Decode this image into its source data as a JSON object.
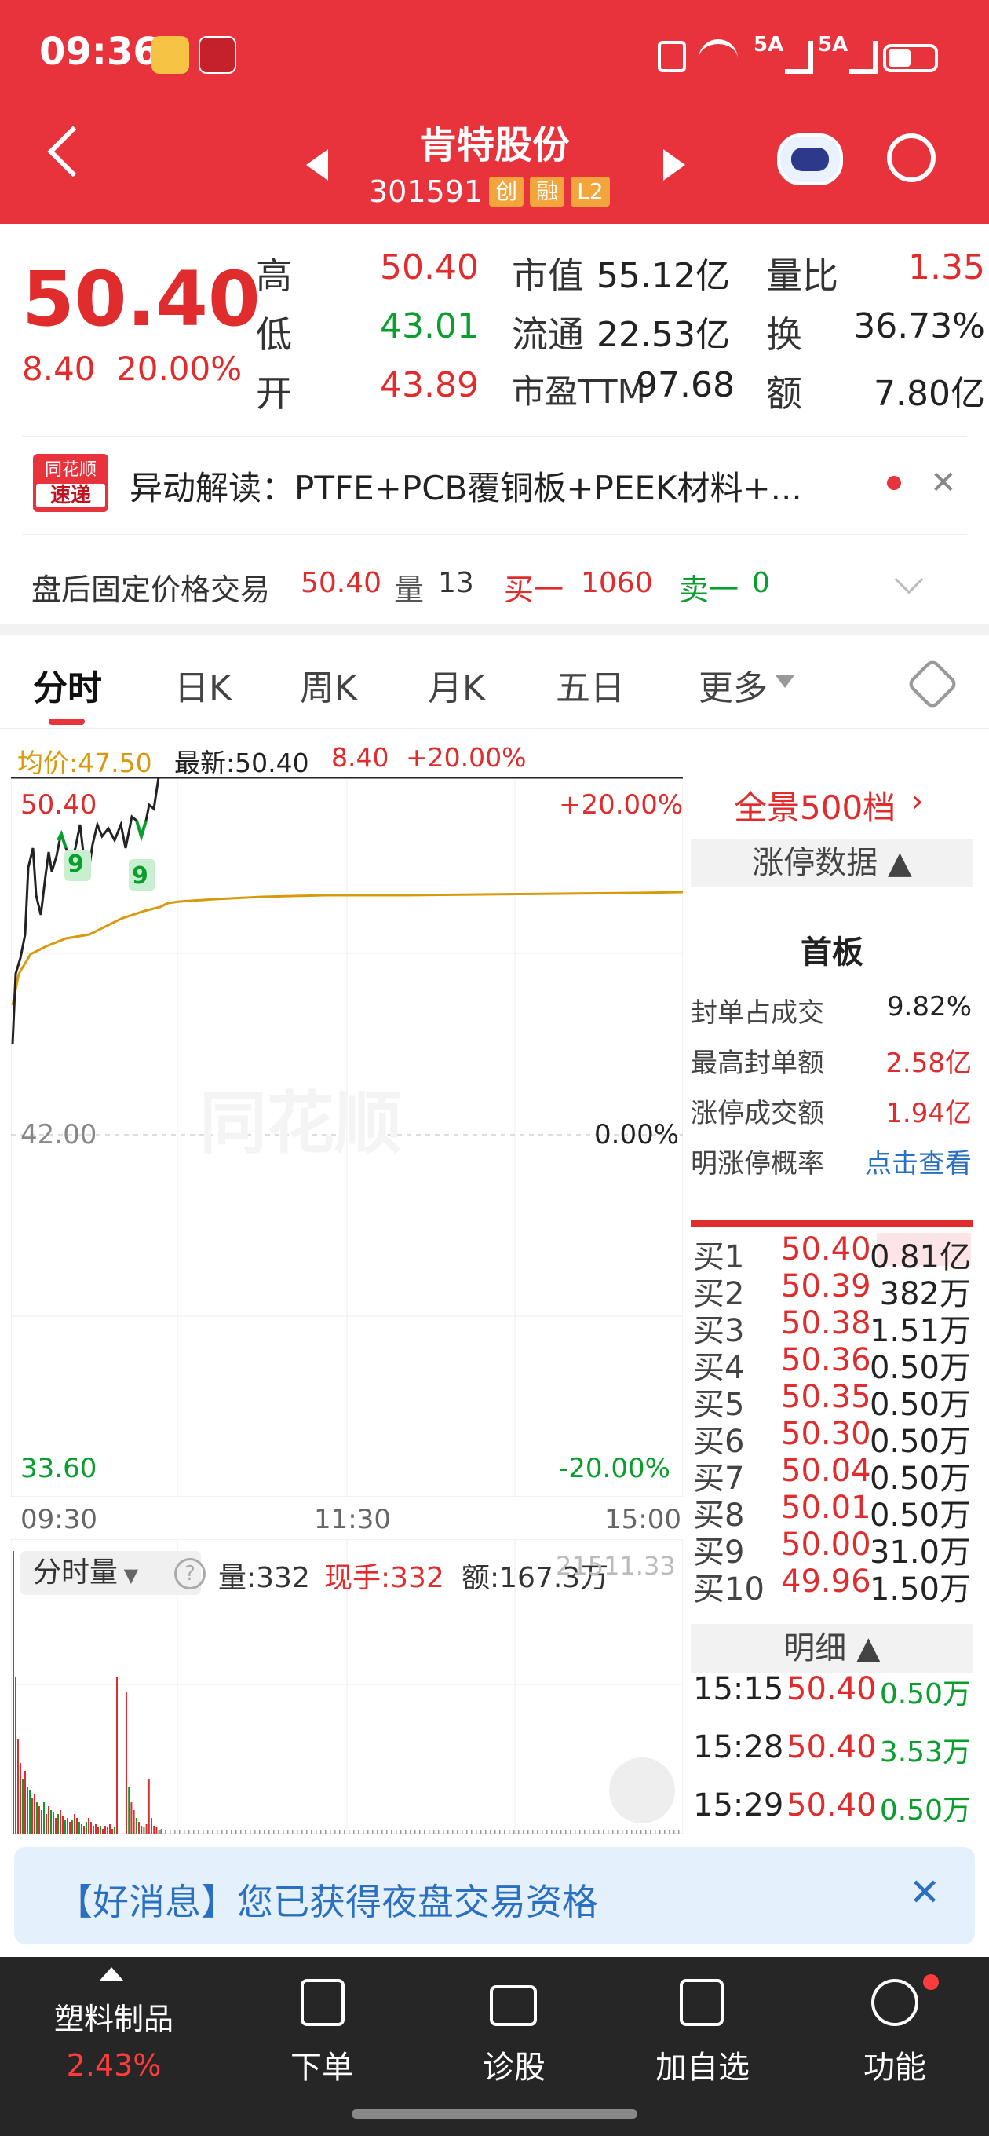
{
  "status_bar": {
    "time": "09:36",
    "signal1": "5A",
    "signal2": "5A"
  },
  "header": {
    "title": "肯特股份",
    "code": "301591",
    "tags": [
      "创",
      "融",
      "L2"
    ]
  },
  "quote": {
    "price": "50.40",
    "change": "8.40",
    "change_pct": "20.00%",
    "high_label": "高",
    "high": "50.40",
    "low_label": "低",
    "low": "43.01",
    "open_label": "开",
    "open": "43.89",
    "mcap_label": "市值",
    "mcap": "55.12亿",
    "float_label": "流通",
    "float": "22.53亿",
    "pe_label": "市盈TTM",
    "pe": "97.68",
    "vr_label": "量比",
    "vr": "1.35",
    "turn_label": "换",
    "turn": "36.73%",
    "amt_label": "额",
    "amt": "7.80亿"
  },
  "news": {
    "logo_top": "同花顺",
    "logo_bottom": "速递",
    "text": "异动解读：PTFE+PCB覆铜板+PEEK材料+..."
  },
  "after_hours": {
    "label": "盘后固定价格交易",
    "price": "50.40",
    "vol_label": "量",
    "vol": "13",
    "buy_label": "买一",
    "buy": "1060",
    "sell_label": "卖一",
    "sell": "0"
  },
  "tabs": [
    "分时",
    "日K",
    "周K",
    "月K",
    "五日",
    "更多"
  ],
  "chart_info": {
    "avg": "均价:47.50",
    "latest_label": "最新:50.40",
    "chg": "8.40",
    "chg_pct": "+20.00%"
  },
  "chart_axis": {
    "top": "50.40",
    "top_pct": "+20.00%",
    "mid": "42.00",
    "mid_pct": "0.00%",
    "bot": "33.60",
    "bot_pct": "-20.00%",
    "t1": "09:30",
    "t2": "11:30",
    "t3": "15:00",
    "watermark": "同花顺"
  },
  "markers": [
    "9",
    "9"
  ],
  "right_panel": {
    "panorama": "全景500档",
    "limit_title": "涨停数据",
    "board": "首板",
    "rows": [
      {
        "label": "封单占成交",
        "value": "9.82%"
      },
      {
        "label": "最高封单额",
        "value": "2.58亿"
      },
      {
        "label": "涨停成交额",
        "value": "1.94亿"
      },
      {
        "label": "明涨停概率",
        "value": "点击查看"
      }
    ],
    "bids": [
      {
        "label": "买1",
        "price": "50.40",
        "vol": "0.81亿"
      },
      {
        "label": "买2",
        "price": "50.39",
        "vol": "382万"
      },
      {
        "label": "买3",
        "price": "50.38",
        "vol": "1.51万"
      },
      {
        "label": "买4",
        "price": "50.36",
        "vol": "0.50万"
      },
      {
        "label": "买5",
        "price": "50.35",
        "vol": "0.50万"
      },
      {
        "label": "买6",
        "price": "50.30",
        "vol": "0.50万"
      },
      {
        "label": "买7",
        "price": "50.04",
        "vol": "0.50万"
      },
      {
        "label": "买8",
        "price": "50.01",
        "vol": "0.50万"
      },
      {
        "label": "买9",
        "price": "50.00",
        "vol": "31.0万"
      },
      {
        "label": "买10",
        "price": "49.96",
        "vol": "1.50万"
      }
    ],
    "detail_title": "明细",
    "details": [
      {
        "time": "15:15",
        "price": "50.40",
        "vol": "0.50万"
      },
      {
        "time": "15:28",
        "price": "50.40",
        "vol": "3.53万"
      },
      {
        "time": "15:29",
        "price": "50.40",
        "vol": "0.50万"
      }
    ]
  },
  "volume": {
    "selector": "分时量",
    "vol": "量:332",
    "hand": "现手:332",
    "amt": "额:167.3万",
    "max": "21511.33"
  },
  "banner": {
    "text": "【好消息】您已获得夜盘交易资格"
  },
  "bottom_nav": {
    "sector": "塑料制品",
    "sector_pct": "2.43%",
    "items": [
      "下单",
      "诊股",
      "加自选",
      "功能"
    ]
  }
}
